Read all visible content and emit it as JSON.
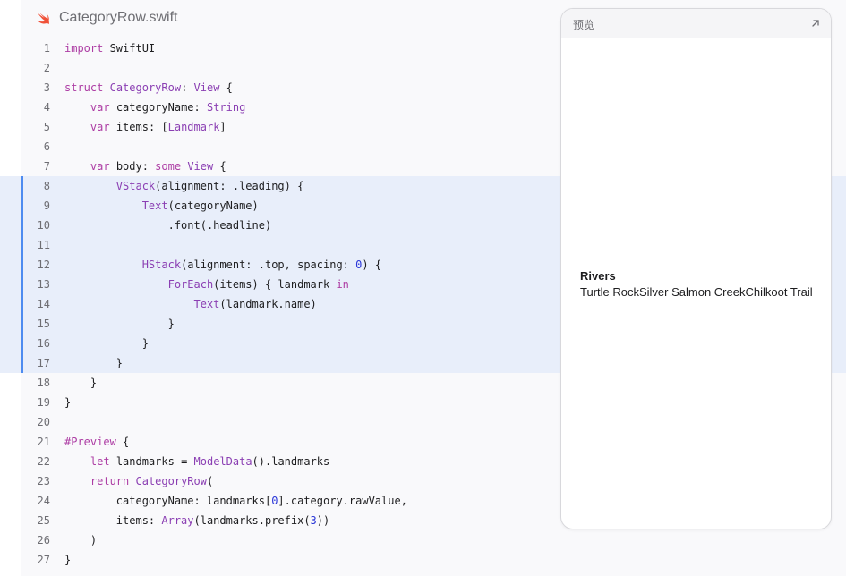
{
  "file": {
    "name": "CategoryRow.swift",
    "icon": "swift-icon"
  },
  "code_lines": [
    {
      "n": "1",
      "hl": false,
      "tokens": [
        [
          "kw",
          "import"
        ],
        [
          "p",
          " SwiftUI"
        ]
      ]
    },
    {
      "n": "2",
      "hl": false,
      "tokens": []
    },
    {
      "n": "3",
      "hl": false,
      "tokens": [
        [
          "kw",
          "struct"
        ],
        [
          "p",
          " "
        ],
        [
          "ty",
          "CategoryRow"
        ],
        [
          "p",
          ": "
        ],
        [
          "ty",
          "View"
        ],
        [
          "p",
          " {"
        ]
      ]
    },
    {
      "n": "4",
      "hl": false,
      "tokens": [
        [
          "p",
          "    "
        ],
        [
          "kw",
          "var"
        ],
        [
          "p",
          " categoryName: "
        ],
        [
          "ty",
          "String"
        ]
      ]
    },
    {
      "n": "5",
      "hl": false,
      "tokens": [
        [
          "p",
          "    "
        ],
        [
          "kw",
          "var"
        ],
        [
          "p",
          " items: ["
        ],
        [
          "ty",
          "Landmark"
        ],
        [
          "p",
          "]"
        ]
      ]
    },
    {
      "n": "6",
      "hl": false,
      "tokens": []
    },
    {
      "n": "7",
      "hl": false,
      "tokens": [
        [
          "p",
          "    "
        ],
        [
          "kw",
          "var"
        ],
        [
          "p",
          " body: "
        ],
        [
          "kw",
          "some"
        ],
        [
          "p",
          " "
        ],
        [
          "ty",
          "View"
        ],
        [
          "p",
          " {"
        ]
      ]
    },
    {
      "n": "8",
      "hl": true,
      "tokens": [
        [
          "p",
          "        "
        ],
        [
          "ty",
          "VStack"
        ],
        [
          "p",
          "(alignment: .leading) {"
        ]
      ]
    },
    {
      "n": "9",
      "hl": true,
      "tokens": [
        [
          "p",
          "            "
        ],
        [
          "ty",
          "Text"
        ],
        [
          "p",
          "(categoryName)"
        ]
      ]
    },
    {
      "n": "10",
      "hl": true,
      "tokens": [
        [
          "p",
          "                .font(.headline)"
        ]
      ]
    },
    {
      "n": "11",
      "hl": true,
      "tokens": []
    },
    {
      "n": "12",
      "hl": true,
      "tokens": [
        [
          "p",
          "            "
        ],
        [
          "ty",
          "HStack"
        ],
        [
          "p",
          "(alignment: .top, spacing: "
        ],
        [
          "num",
          "0"
        ],
        [
          "p",
          ") {"
        ]
      ]
    },
    {
      "n": "13",
      "hl": true,
      "tokens": [
        [
          "p",
          "                "
        ],
        [
          "ty",
          "ForEach"
        ],
        [
          "p",
          "(items) { landmark "
        ],
        [
          "kw",
          "in"
        ]
      ]
    },
    {
      "n": "14",
      "hl": true,
      "tokens": [
        [
          "p",
          "                    "
        ],
        [
          "ty",
          "Text"
        ],
        [
          "p",
          "(landmark.name)"
        ]
      ]
    },
    {
      "n": "15",
      "hl": true,
      "tokens": [
        [
          "p",
          "                }"
        ]
      ]
    },
    {
      "n": "16",
      "hl": true,
      "tokens": [
        [
          "p",
          "            }"
        ]
      ]
    },
    {
      "n": "17",
      "hl": true,
      "tokens": [
        [
          "p",
          "        }"
        ]
      ]
    },
    {
      "n": "18",
      "hl": false,
      "tokens": [
        [
          "p",
          "    }"
        ]
      ]
    },
    {
      "n": "19",
      "hl": false,
      "tokens": [
        [
          "p",
          "}"
        ]
      ]
    },
    {
      "n": "20",
      "hl": false,
      "tokens": []
    },
    {
      "n": "21",
      "hl": false,
      "tokens": [
        [
          "kw",
          "#Preview"
        ],
        [
          "p",
          " {"
        ]
      ]
    },
    {
      "n": "22",
      "hl": false,
      "tokens": [
        [
          "p",
          "    "
        ],
        [
          "kw",
          "let"
        ],
        [
          "p",
          " landmarks = "
        ],
        [
          "ty",
          "ModelData"
        ],
        [
          "p",
          "().landmarks"
        ]
      ]
    },
    {
      "n": "23",
      "hl": false,
      "tokens": [
        [
          "p",
          "    "
        ],
        [
          "kw",
          "return"
        ],
        [
          "p",
          " "
        ],
        [
          "ty",
          "CategoryRow"
        ],
        [
          "p",
          "("
        ]
      ]
    },
    {
      "n": "24",
      "hl": false,
      "tokens": [
        [
          "p",
          "        categoryName: landmarks["
        ],
        [
          "num",
          "0"
        ],
        [
          "p",
          "].category.rawValue,"
        ]
      ]
    },
    {
      "n": "25",
      "hl": false,
      "tokens": [
        [
          "p",
          "        items: "
        ],
        [
          "ty",
          "Array"
        ],
        [
          "p",
          "(landmarks.prefix("
        ],
        [
          "num",
          "3"
        ],
        [
          "p",
          "))"
        ]
      ]
    },
    {
      "n": "26",
      "hl": false,
      "tokens": [
        [
          "p",
          "    )"
        ]
      ]
    },
    {
      "n": "27",
      "hl": false,
      "tokens": [
        [
          "p",
          "}"
        ]
      ]
    }
  ],
  "preview": {
    "title": "预览",
    "expand_icon": "expand-arrow-icon",
    "category": "Rivers",
    "items": [
      "Turtle Rock",
      "Silver Salmon Creek",
      "Chilkoot Trail"
    ]
  },
  "colors": {
    "keyword": "#ad3da4",
    "type": "#8b3fb3",
    "number": "#2a36d8",
    "highlight": "#e8eefa",
    "highlight_bar": "#4d8bf0",
    "swift_orange": "#f05138"
  }
}
